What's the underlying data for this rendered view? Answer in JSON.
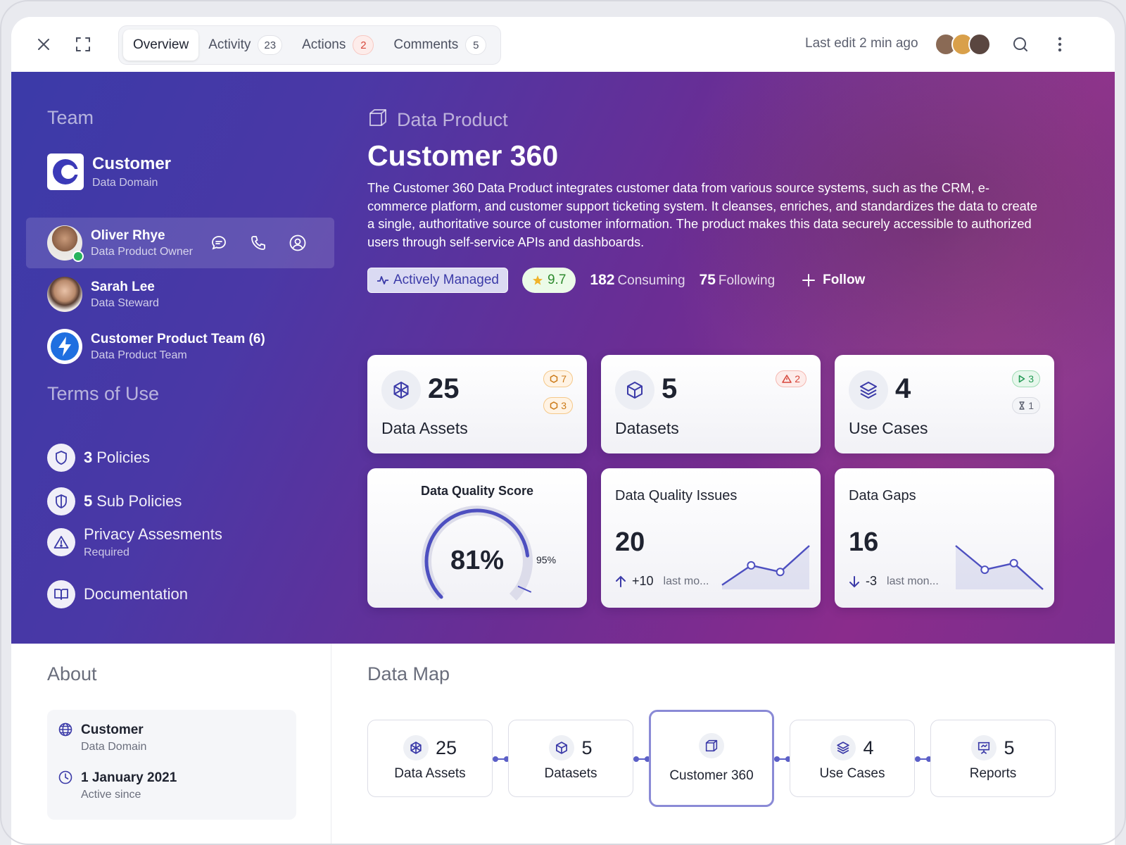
{
  "tabs": [
    {
      "label": "Overview",
      "count": null
    },
    {
      "label": "Activity",
      "count": "23"
    },
    {
      "label": "Actions",
      "count": "2"
    },
    {
      "label": "Comments",
      "count": "5"
    }
  ],
  "header": {
    "last_edit": "Last edit 2 min ago"
  },
  "team": {
    "title": "Team",
    "domain": {
      "name": "Customer",
      "role": "Data Domain"
    },
    "members": [
      {
        "name": "Oliver Rhye",
        "role": "Data Product Owner"
      },
      {
        "name": "Sarah Lee",
        "role": "Data Steward"
      },
      {
        "name": "Customer Product Team (6)",
        "role": "Data Product Team"
      }
    ]
  },
  "terms": {
    "title": "Terms of Use",
    "items": [
      {
        "count": "3",
        "label": "Policies"
      },
      {
        "count": "5",
        "label": "Sub Policies"
      },
      {
        "label": "Privacy Assesments",
        "sub": "Required"
      },
      {
        "label": "Documentation"
      }
    ]
  },
  "product": {
    "type_label": "Data Product",
    "title": "Customer 360",
    "description": "The Customer 360 Data Product integrates customer data from various source systems, such as the CRM, e-commerce platform, and customer support ticketing system. It cleanses, enriches, and standardizes the data to create a single, authoritative source of customer information. The product makes this data securely accessible to authorized users through self-service APIs and dashboards.",
    "status": "Actively Managed",
    "rating": "9.7",
    "consuming_count": "182",
    "consuming_label": "Consuming",
    "following_count": "75",
    "following_label": "Following",
    "follow_label": "Follow"
  },
  "stat_cards": [
    {
      "count": "25",
      "label": "Data Assets",
      "badges": [
        "7",
        "3"
      ]
    },
    {
      "count": "5",
      "label": "Datasets",
      "badges": [
        "2"
      ]
    },
    {
      "count": "4",
      "label": "Use Cases",
      "badges": [
        "3",
        "1"
      ]
    }
  ],
  "quality": {
    "title": "Data Quality Score",
    "value": "81%",
    "value_fraction": 0.81,
    "target": "95%",
    "target_fraction": 0.95
  },
  "issues": {
    "title": "Data Quality Issues",
    "value": "20",
    "delta": "+10",
    "period": "last mo...",
    "trend": [
      0.1,
      0.55,
      0.4,
      1.0
    ]
  },
  "gaps": {
    "title": "Data Gaps",
    "value": "16",
    "delta": "-3",
    "period": "last mon...",
    "trend": [
      1.0,
      0.45,
      0.6,
      0.0
    ]
  },
  "about": {
    "title": "About",
    "domain": {
      "main": "Customer",
      "sub": "Data Domain"
    },
    "since": {
      "main": "1 January 2021",
      "sub": "Active since"
    }
  },
  "data_map": {
    "title": "Data Map",
    "nodes": [
      {
        "count": "25",
        "label": "Data Assets"
      },
      {
        "count": "5",
        "label": "Datasets"
      },
      {
        "count": "",
        "label": "Customer 360"
      },
      {
        "count": "4",
        "label": "Use Cases"
      },
      {
        "count": "5",
        "label": "Reports"
      }
    ]
  },
  "colors": {
    "accent": "#3b3aa8",
    "hero_start": "#3b3aa8",
    "hero_end": "#8a2c8c",
    "gauge": "#4d4fc0",
    "online": "#27b35c"
  },
  "icons": {
    "close": "close-icon",
    "expand": "expand-icon",
    "search": "search-icon",
    "more": "more-vertical-icon",
    "chat": "chat-icon",
    "phone": "phone-icon",
    "profile": "user-circle-icon",
    "shield": "shield-icon",
    "warning": "warning-icon",
    "book": "book-icon",
    "cube": "cube-icon",
    "layers": "layers-icon",
    "asset": "asset-icon",
    "report": "presentation-icon",
    "globe": "globe-icon",
    "clock": "clock-icon",
    "bolt": "bolt-icon",
    "star": "star-icon",
    "plus": "plus-icon"
  }
}
